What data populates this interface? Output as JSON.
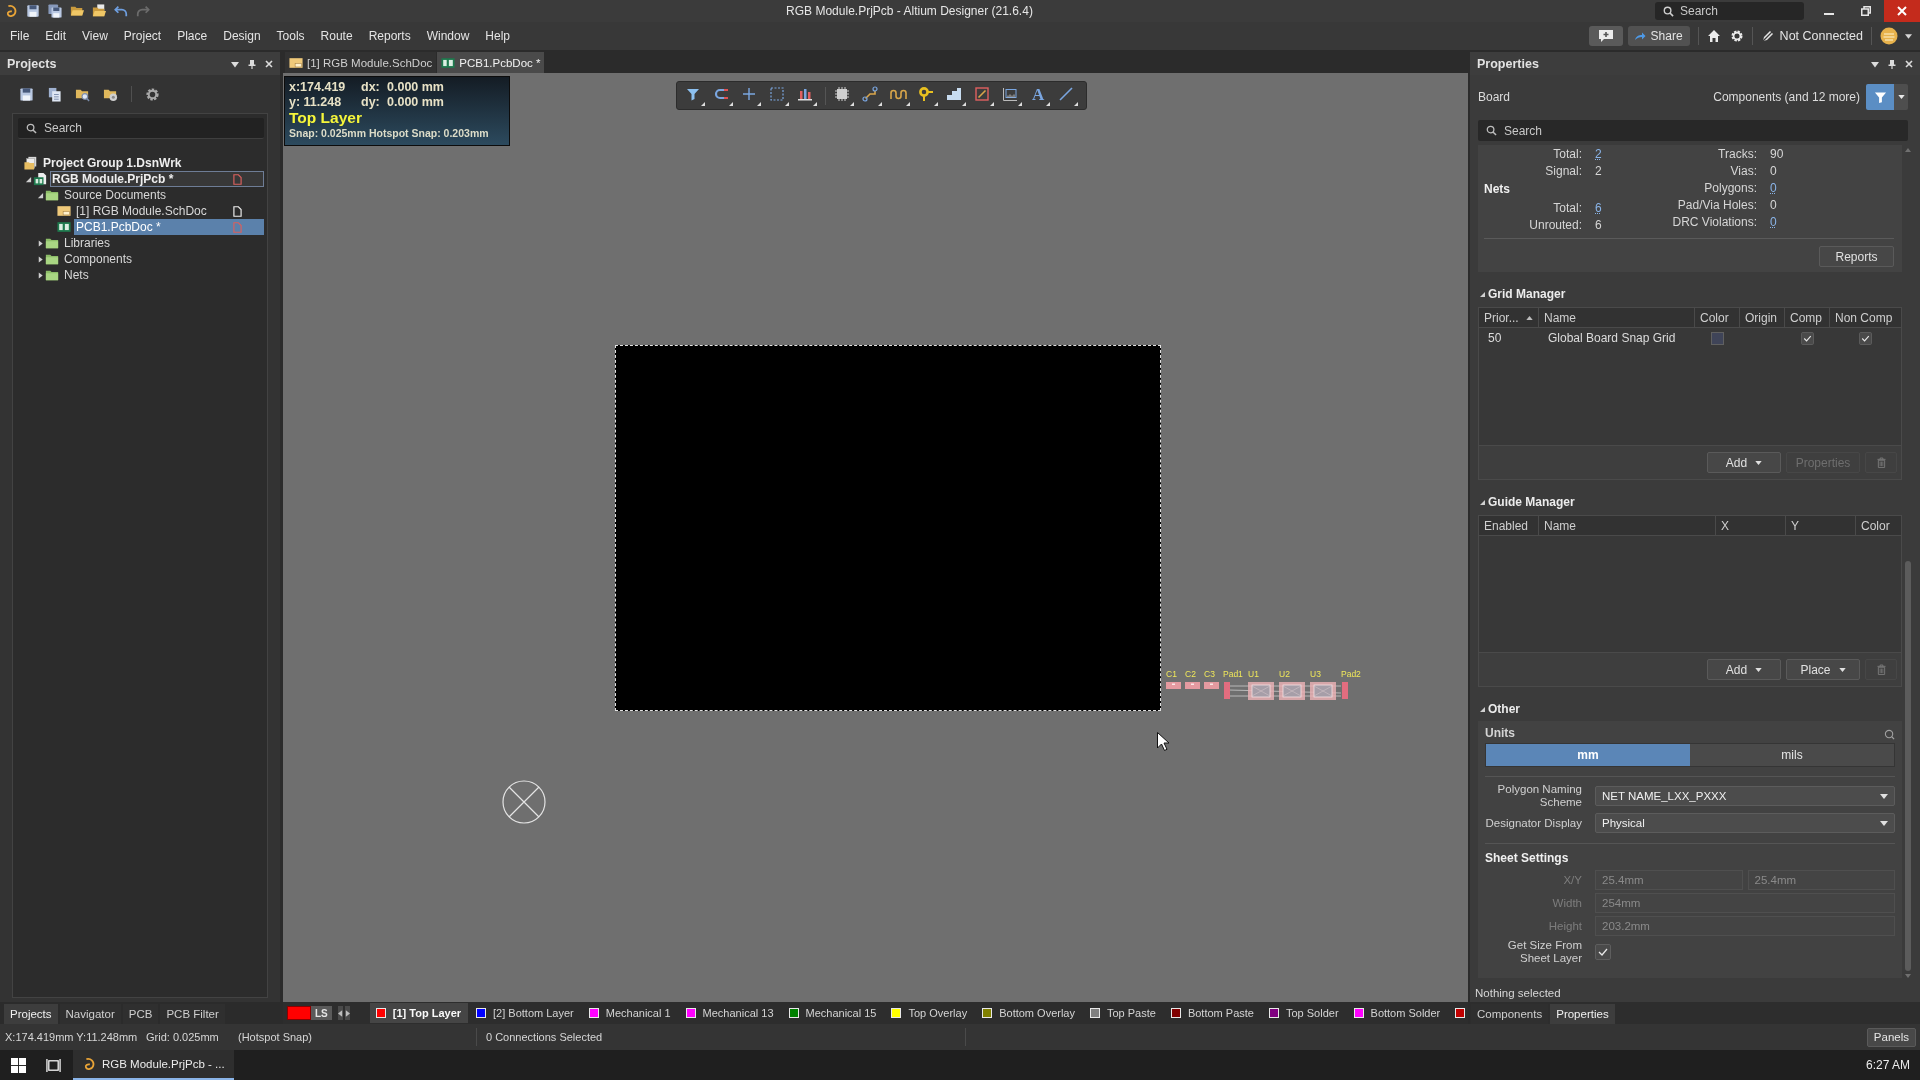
{
  "window": {
    "title": "RGB Module.PrjPcb - Altium Designer (21.6.4)",
    "search_placeholder": "Search"
  },
  "menu": [
    "File",
    "Edit",
    "View",
    "Project",
    "Place",
    "Design",
    "Tools",
    "Route",
    "Reports",
    "Window",
    "Help"
  ],
  "account_bar": {
    "share": "Share",
    "connection": "Not Connected"
  },
  "projects_panel": {
    "title": "Projects",
    "search_placeholder": "Search",
    "tree": [
      {
        "label": "Project Group 1.DsnWrk",
        "kind": "group",
        "selected": false,
        "focused": false,
        "children": [
          {
            "label": "RGB Module.PrjPcb *",
            "kind": "project",
            "expanded": true,
            "selected": false,
            "focused": true,
            "modified": true,
            "children": [
              {
                "label": "Source Documents",
                "kind": "folder",
                "expanded": true,
                "selected": false,
                "focused": false,
                "children": [
                  {
                    "label": "[1] RGB Module.SchDoc",
                    "kind": "schdoc",
                    "selected": false,
                    "focused": false,
                    "modified": false
                  },
                  {
                    "label": "PCB1.PcbDoc *",
                    "kind": "pcbdoc",
                    "selected": true,
                    "focused": false,
                    "modified": true
                  }
                ]
              },
              {
                "label": "Libraries",
                "kind": "folder",
                "expanded": false,
                "selected": false,
                "focused": false
              },
              {
                "label": "Components",
                "kind": "folder",
                "expanded": false,
                "selected": false,
                "focused": false
              },
              {
                "label": "Nets",
                "kind": "folder",
                "expanded": false,
                "selected": false,
                "focused": false
              }
            ]
          }
        ]
      }
    ],
    "tabs": [
      {
        "label": "Projects",
        "selected": true
      },
      {
        "label": "Navigator",
        "selected": false
      },
      {
        "label": "PCB",
        "selected": false
      },
      {
        "label": "PCB Filter",
        "selected": false
      }
    ]
  },
  "document_tabs": [
    {
      "label": "[1] RGB Module.SchDoc",
      "kind": "schdoc",
      "selected": false
    },
    {
      "label": "PCB1.PcbDoc *",
      "kind": "pcbdoc",
      "selected": true
    }
  ],
  "hud": {
    "rows": [
      {
        "coord": "x:174.419",
        "delta_label": "dx:",
        "delta": "0.000 mm"
      },
      {
        "coord": "y: 11.248",
        "delta_label": "dy:",
        "delta": "0.000 mm"
      }
    ],
    "layer": "Top Layer",
    "snap": "Snap: 0.025mm Hotspot Snap: 0.203mm"
  },
  "pcb_toolbar": {
    "text_glyph": "A"
  },
  "canvas": {
    "components": [
      {
        "designator": "C1",
        "kind": "capacitor"
      },
      {
        "designator": "C2",
        "kind": "capacitor"
      },
      {
        "designator": "C3",
        "kind": "capacitor"
      },
      {
        "designator": "Pad1",
        "kind": "pad"
      },
      {
        "designator": "U1",
        "kind": "ic"
      },
      {
        "designator": "U2",
        "kind": "ic"
      },
      {
        "designator": "U3",
        "kind": "ic"
      },
      {
        "designator": "Pad2",
        "kind": "pad"
      }
    ]
  },
  "layer_bar": {
    "ls_label": "LS",
    "layers": [
      {
        "label": "[1] Top Layer",
        "color": "#ff0000",
        "selected": true
      },
      {
        "label": "[2] Bottom Layer",
        "color": "#0000ff",
        "selected": false
      },
      {
        "label": "Mechanical 1",
        "color": "#ff00ff",
        "selected": false
      },
      {
        "label": "Mechanical 13",
        "color": "#ff00ff",
        "selected": false
      },
      {
        "label": "Mechanical 15",
        "color": "#008000",
        "selected": false
      },
      {
        "label": "Top Overlay",
        "color": "#ffff00",
        "selected": false
      },
      {
        "label": "Bottom Overlay",
        "color": "#808000",
        "selected": false
      },
      {
        "label": "Top Paste",
        "color": "#808080",
        "selected": false
      },
      {
        "label": "Bottom Paste",
        "color": "#800000",
        "selected": false
      },
      {
        "label": "Top Solder",
        "color": "#800080",
        "selected": false
      },
      {
        "label": "Bottom Solder",
        "color": "#ff00ff",
        "selected": false
      },
      {
        "color": "#c00000",
        "selected": false
      }
    ]
  },
  "properties_panel": {
    "title": "Properties",
    "object": "Board",
    "filter": "Components (and 12 more)",
    "search_placeholder": "Search",
    "stats_left": [
      {
        "kind": "stat",
        "label": "Total:",
        "value": "2",
        "link": true
      },
      {
        "kind": "stat",
        "label": "Signal:",
        "value": "2",
        "link": false
      },
      {
        "kind": "heading",
        "label": "Nets"
      },
      {
        "kind": "stat",
        "label": "Total:",
        "value": "6",
        "link": true
      },
      {
        "kind": "stat",
        "label": "Unrouted:",
        "value": "6",
        "link": false
      }
    ],
    "stats_right": [
      {
        "label": "Tracks:",
        "value": "90",
        "link": false
      },
      {
        "label": "Vias:",
        "value": "0",
        "link": false
      },
      {
        "label": "Polygons:",
        "value": "0",
        "link": true
      },
      {
        "label": "Pad/Via Holes:",
        "value": "0",
        "link": false
      },
      {
        "label": "DRC Violations:",
        "value": "0",
        "link": true
      }
    ],
    "reports_button": "Reports",
    "grid_manager": {
      "title": "Grid Manager",
      "expanded": true,
      "columns": [
        {
          "label": "Prior...",
          "sorted": true
        },
        {
          "label": "Name",
          "sorted": false
        },
        {
          "label": "Color",
          "sorted": false
        },
        {
          "label": "Origin",
          "sorted": false
        },
        {
          "label": "Comp",
          "sorted": false
        },
        {
          "label": "Non Comp",
          "sorted": false
        }
      ],
      "rows": [
        {
          "priority": "50",
          "name": "Global Board Snap Grid",
          "color": "#3f4458",
          "comp": true,
          "non_comp": true
        }
      ],
      "buttons": [
        {
          "kind": "dropdown",
          "label": "Add",
          "disabled": false
        },
        {
          "kind": "plain",
          "label": "Properties",
          "disabled": true
        },
        {
          "kind": "trash",
          "disabled": true
        }
      ]
    },
    "guide_manager": {
      "title": "Guide Manager",
      "expanded": true,
      "columns": [
        {
          "label": "Enabled"
        },
        {
          "label": "Name"
        },
        {
          "label": "X"
        },
        {
          "label": "Y"
        },
        {
          "label": "Color"
        }
      ],
      "buttons": [
        {
          "kind": "dropdown",
          "label": "Add",
          "disabled": false
        },
        {
          "kind": "dropdown",
          "label": "Place",
          "disabled": false
        },
        {
          "kind": "trash",
          "disabled": true
        }
      ]
    },
    "other": {
      "title": "Other",
      "expanded": true,
      "units_label": "Units",
      "units": [
        {
          "label": "mm",
          "selected": true
        },
        {
          "label": "mils",
          "selected": false
        }
      ],
      "fields": [
        {
          "label": "Polygon Naming Scheme",
          "value": "NET NAME_LXX_PXXX"
        },
        {
          "label": "Designator Display",
          "value": "Physical"
        }
      ],
      "sheet_title": "Sheet Settings",
      "sheet_fields": [
        {
          "kind": "pair",
          "label": "X/Y",
          "values": [
            "25.4mm",
            "25.4mm"
          ],
          "disabled": true
        },
        {
          "kind": "text",
          "label": "Width",
          "value": "254mm",
          "disabled": true
        },
        {
          "kind": "text",
          "label": "Height",
          "value": "203.2mm",
          "disabled": true
        },
        {
          "kind": "checkbox",
          "label": "Get Size From Sheet Layer",
          "checked": true
        }
      ]
    },
    "selection_status": "Nothing selected",
    "tabs": [
      {
        "label": "Components",
        "selected": false
      },
      {
        "label": "Properties",
        "selected": true
      }
    ]
  },
  "status_bar": {
    "coordinates": "X:174.419mm Y:11.248mm",
    "grid": "Grid: 0.025mm",
    "snap": "(Hotspot Snap)",
    "connections": "0 Connections Selected",
    "panels_button": "Panels"
  },
  "taskbar": {
    "app": "RGB Module.PrjPcb - ...",
    "time": "6:27 AM"
  }
}
